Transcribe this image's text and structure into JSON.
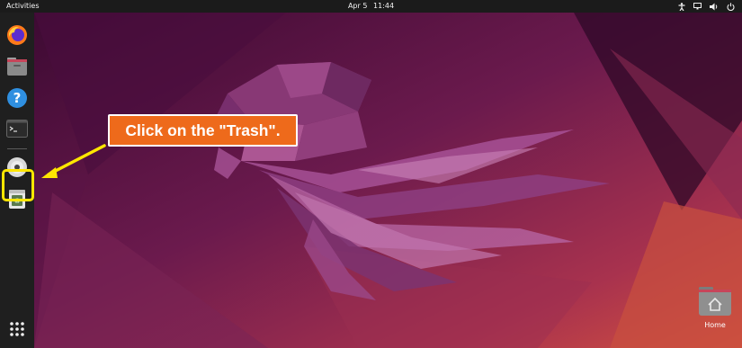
{
  "topbar": {
    "activities": "Activities",
    "date": "Apr 5",
    "time": "11:44",
    "tray_icons": [
      "accessibility-icon",
      "network-icon",
      "volume-icon",
      "power-icon"
    ]
  },
  "dock": {
    "items": [
      {
        "name": "Firefox",
        "icon": "firefox-icon"
      },
      {
        "name": "Files",
        "icon": "files-icon"
      },
      {
        "name": "Help",
        "icon": "help-icon"
      },
      {
        "name": "Terminal",
        "icon": "terminal-icon"
      },
      {
        "name": "Disc",
        "icon": "disc-icon"
      },
      {
        "name": "Trash",
        "icon": "trash-icon"
      }
    ],
    "apps_grid_icon": "show-apps-icon"
  },
  "annotation": {
    "callout_text": "Click on the \"Trash\".",
    "highlight_color": "#ffe600",
    "callout_color": "#ee6a1b"
  },
  "desktop": {
    "home_label": "Home"
  },
  "colors": {
    "topbar": "#1b1b1b",
    "dock": "#1f1f1f",
    "wallpaper_dark": "#3b0a2e",
    "wallpaper_light": "#c2484f"
  }
}
